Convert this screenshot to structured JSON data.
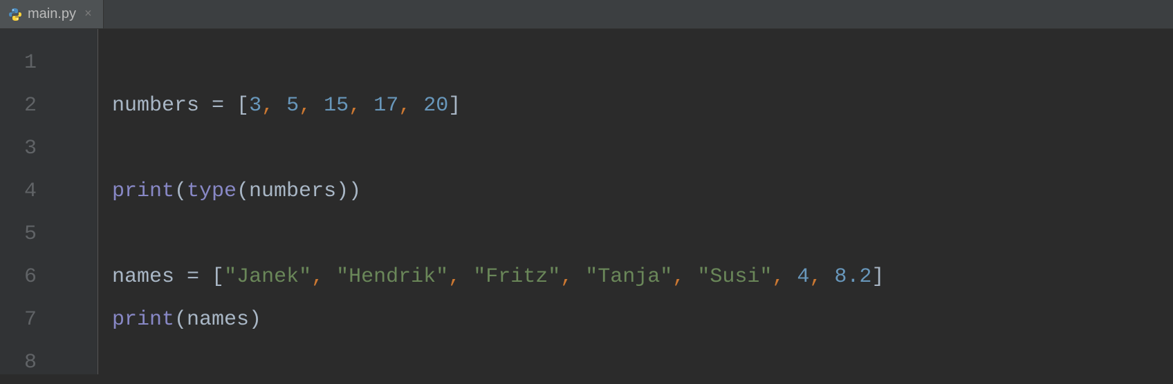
{
  "tab": {
    "filename": "main.py",
    "close_glyph": "×"
  },
  "gutter": {
    "lines": [
      "1",
      "2",
      "3",
      "4",
      "5",
      "6",
      "7",
      "8"
    ]
  },
  "code": {
    "line1": [],
    "line2": [
      {
        "t": "numbers ",
        "c": "tok-default"
      },
      {
        "t": "= ",
        "c": "tok-operator"
      },
      {
        "t": "[",
        "c": "tok-bracket"
      },
      {
        "t": "3",
        "c": "tok-number"
      },
      {
        "t": ",",
        "c": "tok-comma"
      },
      {
        "t": " ",
        "c": "tok-default"
      },
      {
        "t": "5",
        "c": "tok-number"
      },
      {
        "t": ",",
        "c": "tok-comma"
      },
      {
        "t": " ",
        "c": "tok-default"
      },
      {
        "t": "15",
        "c": "tok-number"
      },
      {
        "t": ",",
        "c": "tok-comma"
      },
      {
        "t": " ",
        "c": "tok-default"
      },
      {
        "t": "17",
        "c": "tok-number"
      },
      {
        "t": ",",
        "c": "tok-comma"
      },
      {
        "t": " ",
        "c": "tok-default"
      },
      {
        "t": "20",
        "c": "tok-number"
      },
      {
        "t": "]",
        "c": "tok-bracket"
      }
    ],
    "line3": [],
    "line4": [
      {
        "t": "print",
        "c": "tok-builtin"
      },
      {
        "t": "(",
        "c": "tok-bracket"
      },
      {
        "t": "type",
        "c": "tok-builtin"
      },
      {
        "t": "(numbers))",
        "c": "tok-bracket"
      }
    ],
    "line5": [],
    "line6": [
      {
        "t": "names ",
        "c": "tok-default"
      },
      {
        "t": "= ",
        "c": "tok-operator"
      },
      {
        "t": "[",
        "c": "tok-bracket"
      },
      {
        "t": "\"Janek\"",
        "c": "tok-string"
      },
      {
        "t": ",",
        "c": "tok-comma"
      },
      {
        "t": " ",
        "c": "tok-default"
      },
      {
        "t": "\"Hendrik\"",
        "c": "tok-string"
      },
      {
        "t": ",",
        "c": "tok-comma"
      },
      {
        "t": " ",
        "c": "tok-default"
      },
      {
        "t": "\"Fritz\"",
        "c": "tok-string"
      },
      {
        "t": ",",
        "c": "tok-comma"
      },
      {
        "t": " ",
        "c": "tok-default"
      },
      {
        "t": "\"Tanja\"",
        "c": "tok-string"
      },
      {
        "t": ",",
        "c": "tok-comma"
      },
      {
        "t": " ",
        "c": "tok-default"
      },
      {
        "t": "\"Susi\"",
        "c": "tok-string"
      },
      {
        "t": ",",
        "c": "tok-comma"
      },
      {
        "t": " ",
        "c": "tok-default"
      },
      {
        "t": "4",
        "c": "tok-number"
      },
      {
        "t": ",",
        "c": "tok-comma"
      },
      {
        "t": " ",
        "c": "tok-default"
      },
      {
        "t": "8.2",
        "c": "tok-number"
      },
      {
        "t": "]",
        "c": "tok-bracket"
      }
    ],
    "line7": [
      {
        "t": "print",
        "c": "tok-builtin"
      },
      {
        "t": "(names)",
        "c": "tok-bracket"
      }
    ],
    "line8": []
  }
}
